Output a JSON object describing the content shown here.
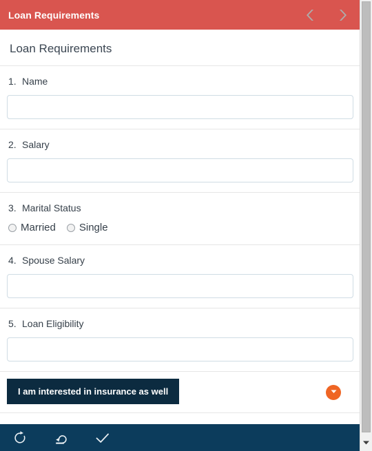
{
  "header": {
    "title": "Loan Requirements",
    "accent_color": "#d9554f",
    "prev_icon": "chevron-left-icon",
    "next_icon": "chevron-right-icon"
  },
  "form": {
    "title": "Loan Requirements",
    "questions": [
      {
        "number": "1.",
        "label": "Name",
        "type": "text",
        "value": "",
        "placeholder": ""
      },
      {
        "number": "2.",
        "label": "Salary",
        "type": "text",
        "value": "",
        "placeholder": ""
      },
      {
        "number": "3.",
        "label": "Marital Status",
        "type": "radio",
        "options": [
          {
            "label": "Married",
            "selected": false
          },
          {
            "label": "Single",
            "selected": false
          }
        ]
      },
      {
        "number": "4.",
        "label": "Spouse Salary",
        "type": "text",
        "value": "",
        "placeholder": ""
      },
      {
        "number": "5.",
        "label": "Loan Eligibility",
        "type": "text",
        "value": "",
        "placeholder": ""
      }
    ]
  },
  "actions": {
    "interest_button_label": "I am interested in insurance as well",
    "interest_button_color": "#0c2b40",
    "fab_icon": "triangle-down-icon",
    "fab_color": "#ef6524"
  },
  "toolbar": {
    "background_color": "#0c3c5c",
    "buttons": [
      {
        "name": "refresh-icon",
        "label": "Refresh"
      },
      {
        "name": "save-upload-icon",
        "label": "Save"
      },
      {
        "name": "check-icon",
        "label": "Submit"
      }
    ]
  },
  "scrollbar": {
    "thumb_icon": "scrollbar-thumb",
    "down_arrow_icon": "triangle-down-icon"
  }
}
